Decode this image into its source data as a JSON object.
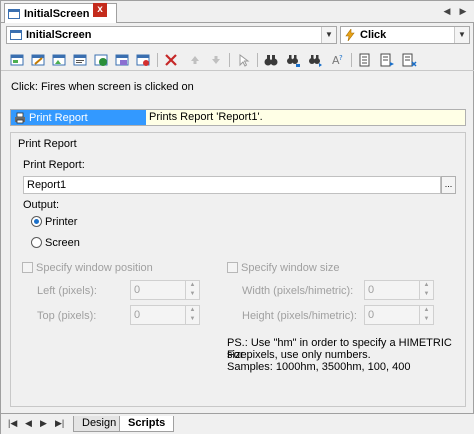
{
  "tab": {
    "title": "InitialScreen",
    "close": "x"
  },
  "nav": {
    "left": "◀",
    "right": "▶"
  },
  "combo_object": {
    "value": "InitialScreen"
  },
  "combo_event": {
    "value": "Click"
  },
  "toolbar": {
    "icons": [
      "new-script-icon",
      "edit-script-icon",
      "image-icon",
      "properties-icon",
      "record-icon",
      "export-icon",
      "delete-icon",
      "move-up-icon",
      "move-down-icon",
      "cursor-icon",
      "find-icon",
      "replace-icon",
      "find-next-icon",
      "help-icon",
      "bookmark-icon",
      "bookmark-next-icon",
      "bookmark-clear-icon"
    ]
  },
  "description": "Click: Fires when screen is clicked on",
  "script_row": {
    "name": "Print Report",
    "text": "Prints Report 'Report1'."
  },
  "group": {
    "title": "Print Report",
    "report_label": "Print Report:",
    "report_value": "Report1",
    "browse_label": "...",
    "output_label": "Output:",
    "printer_label": "Printer",
    "screen_label": "Screen",
    "output_selected": "Printer",
    "window_pos_label": "Specify window position",
    "window_size_label": "Specify window size",
    "left_label": "Left (pixels):",
    "top_label": "Top (pixels):",
    "width_label": "Width (pixels/himetric):",
    "height_label": "Height (pixels/himetric):",
    "left_value": "0",
    "top_value": "0",
    "width_value": "0",
    "height_value": "0",
    "ps_line1": "PS.: Use \"hm\" in order to specify a HIMETRIC size.",
    "ps_line2": "For pixels, use only numbers.",
    "ps_line3": "Samples: 1000hm, 3500hm, 100, 400"
  },
  "bottom": {
    "nav": [
      "|◀",
      "◀",
      "▶",
      "▶|"
    ],
    "tabs": [
      "Design",
      "Scripts"
    ],
    "active_tab": "Scripts"
  }
}
